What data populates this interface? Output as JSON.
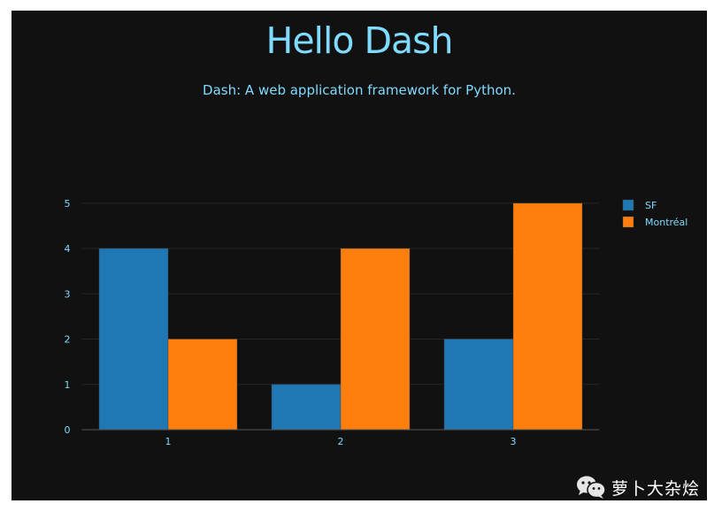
{
  "page": {
    "title": "Hello Dash",
    "subtitle": "Dash: A web application framework for Python.",
    "text_color": "#7FDBFF",
    "background": "#111111"
  },
  "watermark": {
    "icon": "wechat-icon",
    "text": "萝卜大杂烩"
  },
  "chart_data": {
    "type": "bar",
    "barmode": "group",
    "title": "",
    "xlabel": "",
    "ylabel": "",
    "categories": [
      "1",
      "2",
      "3"
    ],
    "series": [
      {
        "name": "SF",
        "values": [
          4,
          1,
          2
        ],
        "color": "#1f77b4"
      },
      {
        "name": "Montréal",
        "values": [
          2,
          4,
          5
        ],
        "color": "#ff7f0e"
      }
    ],
    "yticks": [
      0,
      1,
      2,
      3,
      4,
      5
    ],
    "ylim": [
      0,
      5.26
    ],
    "grid": true,
    "legend": {
      "position": "top-right",
      "entries": [
        "SF",
        "Montréal"
      ]
    }
  }
}
